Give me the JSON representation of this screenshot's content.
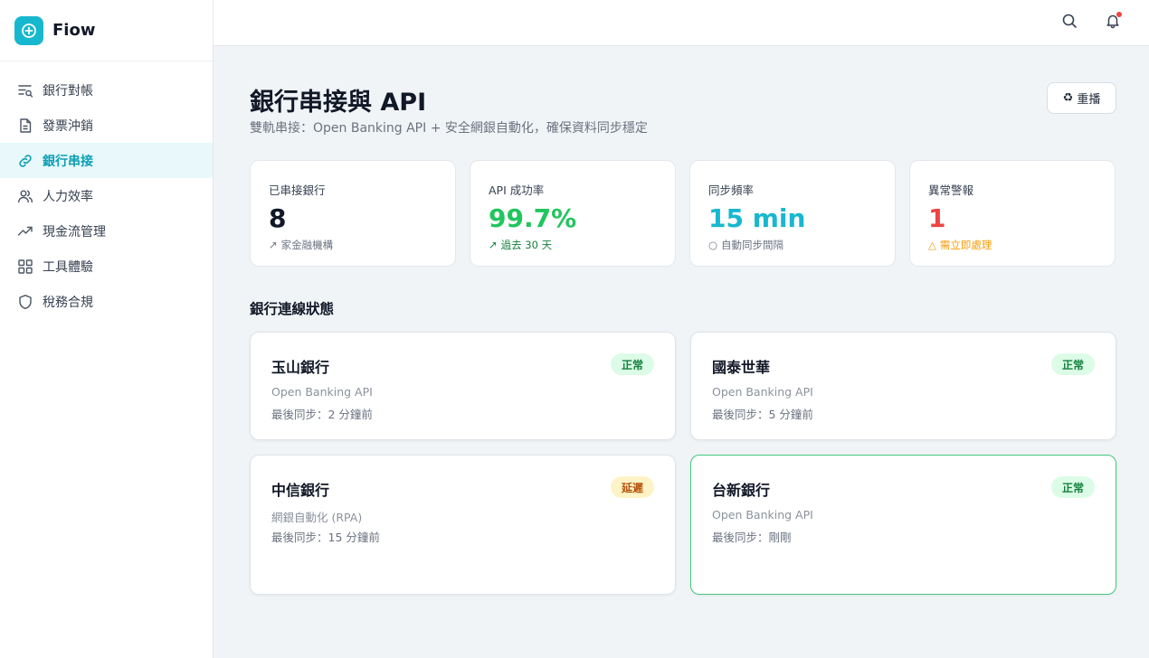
{
  "app": {
    "name": "Fiow"
  },
  "sidebar": {
    "items": [
      {
        "label": "銀行對帳",
        "icon": "reconcile-icon",
        "active": false
      },
      {
        "label": "發票沖銷",
        "icon": "document-icon",
        "active": false
      },
      {
        "label": "銀行串接",
        "icon": "link-icon",
        "active": true
      },
      {
        "label": "人力效率",
        "icon": "users-icon",
        "active": false
      },
      {
        "label": "現金流管理",
        "icon": "trending-up-icon",
        "active": false
      },
      {
        "label": "工具體驗",
        "icon": "grid-icon",
        "active": false
      },
      {
        "label": "稅務合規",
        "icon": "shield-icon",
        "active": false
      }
    ]
  },
  "header": {
    "title": "銀行串接與 API",
    "subtitle": "雙軌串接：Open Banking API + 安全網銀自動化，確保資料同步穩定",
    "replay_icon": "♻",
    "replay_label": "重播"
  },
  "stats": [
    {
      "label": "已串接銀行",
      "value": "8",
      "foot_icon": "↗",
      "foot": "家金融機構",
      "value_color": "#111827",
      "foot_color": "#6b7280"
    },
    {
      "label": "API 成功率",
      "value": "99.7%",
      "foot_icon": "↗",
      "foot": "過去 30 天",
      "value_color": "#22c55e",
      "foot_color": "#15803d"
    },
    {
      "label": "同步頻率",
      "value": "15 min",
      "foot_icon": "○",
      "foot": "自動同步間隔",
      "value_color": "#17b8cf",
      "foot_color": "#6b7280"
    },
    {
      "label": "異常警報",
      "value": "1",
      "foot_icon": "△",
      "foot": "需立即處理",
      "value_color": "#ef4444",
      "foot_color": "#f59e0b"
    }
  ],
  "section": {
    "title": "銀行連線狀態"
  },
  "banks": [
    {
      "name": "玉山銀行",
      "type": "Open Banking API",
      "sync": "最後同步：2 分鐘前",
      "status": "正常",
      "status_kind": "ok"
    },
    {
      "name": "國泰世華",
      "type": "Open Banking API",
      "sync": "最後同步：5 分鐘前",
      "status": "正常",
      "status_kind": "ok"
    },
    {
      "name": "中信銀行",
      "type": "網銀自動化 (RPA)",
      "sync": "最後同步：15 分鐘前",
      "status": "延遲",
      "status_kind": "warn"
    },
    {
      "name": "台新銀行",
      "type": "Open Banking API",
      "sync": "最後同步：剛剛",
      "status": "正常",
      "status_kind": "ok"
    }
  ]
}
